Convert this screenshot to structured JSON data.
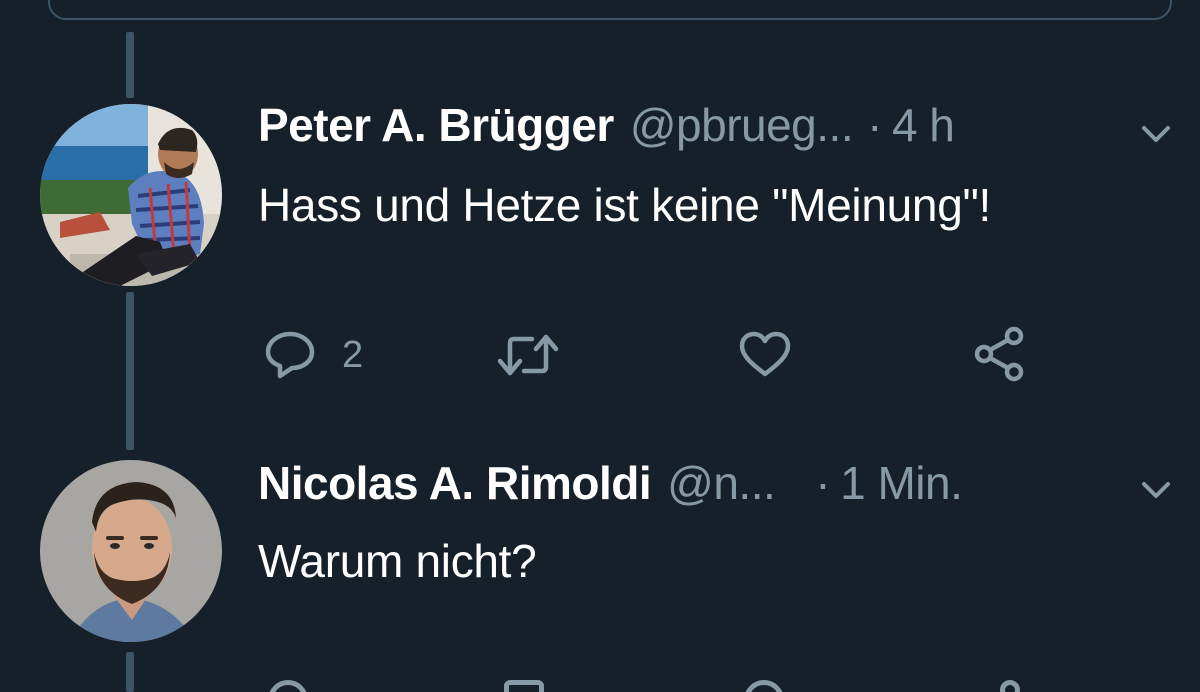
{
  "thread": {
    "tweets": [
      {
        "display_name": "Peter A. Brügger",
        "handle": "@pbrueg...",
        "separator": "·",
        "time": "4 h",
        "text": "Hass und Hetze ist keine \"Meinung\"!",
        "reply_count": "2"
      },
      {
        "display_name": "Nicolas A. Rimoldi",
        "handle": "@n...",
        "separator": "·",
        "time": "1 Min.",
        "text": "Warum nicht?"
      }
    ]
  },
  "icons": {
    "menu": "chevron-down-icon",
    "reply": "reply-icon",
    "retweet": "retweet-icon",
    "like": "heart-icon",
    "share": "share-icon"
  },
  "colors": {
    "background": "#15202b",
    "primary_text": "#ffffff",
    "secondary_text": "#8899a6",
    "thread_line": "#3d5466"
  }
}
